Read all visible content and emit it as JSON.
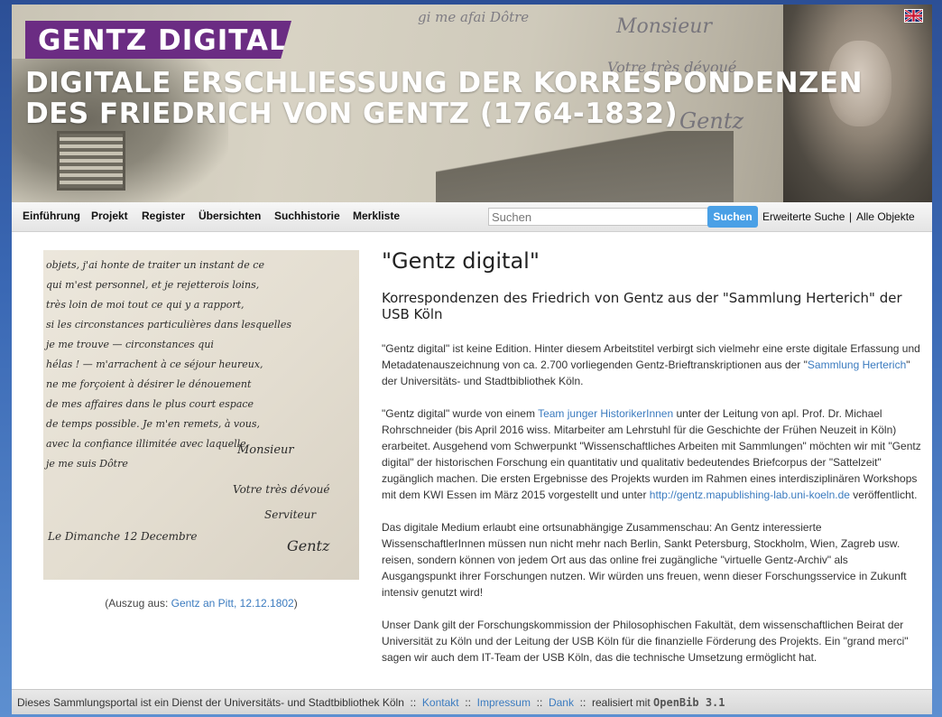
{
  "banner": {
    "label": "GENTZ DIGITAL",
    "title_line1": "DIGITALE ERSCHLIESSUNG DER KORRESPONDENZEN",
    "title_line2": "DES FRIEDRICH VON GENTZ (1764-1832)",
    "language_flag": "uk-flag-icon",
    "accent_color": "#6b2c83"
  },
  "nav": {
    "items": [
      "Einführung",
      "Projekt",
      "Register",
      "Übersichten",
      "Suchhistorie",
      "Merkliste"
    ],
    "search_placeholder": "Suchen",
    "search_button": "Suchen",
    "advanced_search": "Erweiterte Suche",
    "separator": "|",
    "all_objects": "Alle Objekte"
  },
  "main": {
    "image_caption_prefix": "(Auszug aus: ",
    "image_caption_link": "Gentz an Pitt, 12.12.1802",
    "image_caption_suffix": ")",
    "title": "\"Gentz digital\"",
    "subtitle": "Korrespondenzen des Friedrich von Gentz aus der \"Sammlung Herterich\" der USB Köln",
    "p1_a": "\"Gentz digital\" ist keine Edition. Hinter diesem Arbeitstitel verbirgt sich vielmehr eine erste digitale Erfassung und Metadatenauszeichnung von ca. 2.700 vorliegenden Gentz-Brieftranskriptionen aus der \"",
    "p1_link": "Sammlung Herterich",
    "p1_b": "\" der Universitäts- und Stadtbibliothek Köln.",
    "p2_a": "\"Gentz digital\" wurde von einem ",
    "p2_link1": "Team junger HistorikerInnen",
    "p2_b": " unter der Leitung von apl. Prof. Dr. Michael Rohrschneider (bis April 2016 wiss. Mitarbeiter am Lehrstuhl für die Geschichte der Frühen Neuzeit in Köln) erarbeitet. Ausgehend vom Schwerpunkt \"Wissenschaftliches Arbeiten mit Sammlungen\" möchten wir mit \"Gentz digital\" der historischen Forschung ein quantitativ und qualitativ bedeutendes Briefcorpus der \"Sattelzeit\" zugänglich machen. Die ersten Ergebnisse des Projekts wurden im Rahmen eines interdisziplinären Workshops mit dem KWI Essen im März 2015 vorgestellt und unter ",
    "p2_link2": "http://gentz.mapublishing-lab.uni-koeln.de",
    "p2_c": " veröffentlicht.",
    "p3": "Das digitale Medium erlaubt eine ortsunabhängige Zusammenschau: An Gentz interessierte WissenschaftlerInnen müssen nun nicht mehr nach Berlin, Sankt Petersburg, Stockholm, Wien, Zagreb usw. reisen, sondern können von jedem Ort aus das online frei zugängliche \"virtuelle Gentz-Archiv\" als Ausgangspunkt ihrer Forschungen nutzen. Wir würden uns freuen, wenn dieser Forschungsservice in Zukunft intensiv genutzt wird!",
    "p4": "Unser Dank gilt der Forschungskommission der Philosophischen Fakultät, dem wissenschaftlichen Beirat der Universität zu Köln und der Leitung der USB Köln für die finanzielle Förderung des Projekts. Ein \"grand merci\" sagen wir auch dem IT-Team der USB Köln, das die technische Umsetzung ermöglicht hat."
  },
  "footer": {
    "text": "Dieses Sammlungsportal ist ein Dienst der Universitäts- und Stadtbibliothek Köln",
    "sep": "::",
    "kontakt": "Kontakt",
    "impressum": "Impressum",
    "dank": "Dank",
    "realisiert": "realisiert mit",
    "openbib": "OpenBib 3.1"
  }
}
